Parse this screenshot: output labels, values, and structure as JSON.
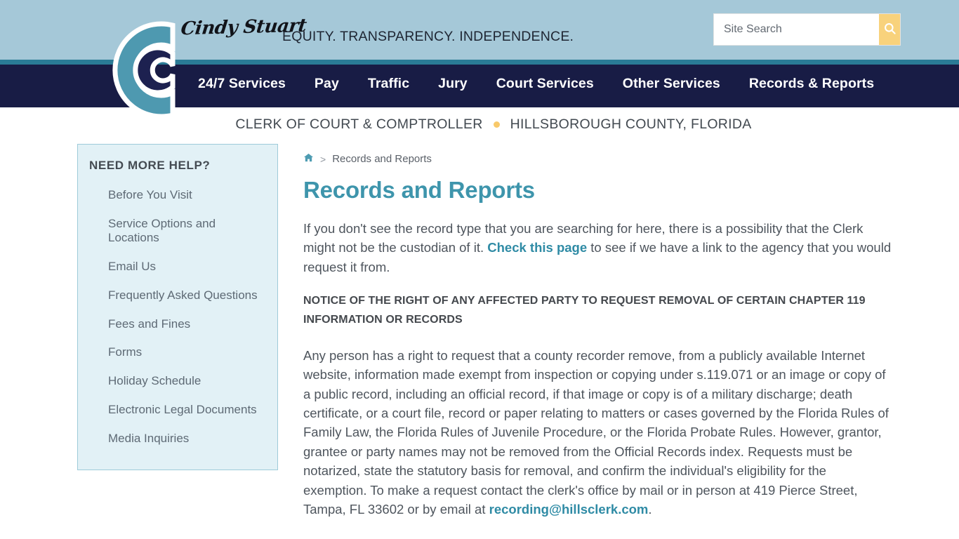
{
  "header": {
    "signature": "Cindy Stuart",
    "tagline": "EQUITY. TRANSPARENCY. INDEPENDENCE.",
    "logo_icon": "nested-c-logo",
    "search": {
      "placeholder": "Site Search",
      "value": "",
      "button_icon": "search-icon"
    }
  },
  "nav": {
    "items": [
      {
        "label": "24/7 Services"
      },
      {
        "label": "Pay"
      },
      {
        "label": "Traffic"
      },
      {
        "label": "Jury"
      },
      {
        "label": "Court Services"
      },
      {
        "label": "Other Services"
      },
      {
        "label": "Records & Reports"
      }
    ]
  },
  "subtitle": {
    "left": "CLERK OF COURT & COMPTROLLER",
    "right": "HILLSBOROUGH COUNTY, FLORIDA",
    "separator_icon": "gold-dot"
  },
  "sidebar": {
    "title": "NEED MORE HELP?",
    "items": [
      {
        "label": "Before You Visit"
      },
      {
        "label": "Service Options and Locations"
      },
      {
        "label": "Email Us"
      },
      {
        "label": "Frequently Asked Questions"
      },
      {
        "label": "Fees and Fines"
      },
      {
        "label": "Forms"
      },
      {
        "label": "Holiday Schedule"
      },
      {
        "label": "Electronic Legal Documents"
      },
      {
        "label": "Media Inquiries"
      }
    ]
  },
  "breadcrumb": {
    "home_icon": "home-icon",
    "separator": ">",
    "current": "Records and Reports"
  },
  "main": {
    "title": "Records and Reports",
    "intro_part1": "If you don't see the record type that you are searching for here, there is a possibility that the Clerk might not be the custodian of it. ",
    "intro_link": "Check this page",
    "intro_part2": " to see if we have a link to the agency that you would request it from.",
    "notice_heading": "NOTICE OF THE RIGHT OF ANY AFFECTED PARTY TO REQUEST REMOVAL OF CERTAIN CHAPTER 119 INFORMATION OR RECORDS",
    "notice_body_part1": "Any person has a right to request that a county recorder remove, from a publicly available Internet website, information made exempt from inspection or copying under s.119.071 or an image or copy of a public record, including an official record, if that image or copy is of a military discharge; death certificate, or a court file, record or paper relating to matters or cases governed by the Florida Rules of Family Law, the Florida Rules of Juvenile Procedure, or the Florida Probate Rules. However, grantor, grantee or party names may not be removed from the Official Records index. Requests must be notarized, state the statutory basis for removal, and confirm the individual's eligibility for the exemption. To make a request contact the clerk's office by mail or in person at 419 Pierce Street, Tampa, FL 33602 or by email at ",
    "notice_email": "recording@hillsclerk.com",
    "notice_body_part2": "."
  },
  "colors": {
    "header_bg": "#a5c8d8",
    "accent_line": "#2a7b96",
    "nav_bg": "#181c45",
    "sidebar_bg": "#e2f1f6",
    "sidebar_border": "#9ecbd9",
    "title_teal": "#3e95ac",
    "link_teal": "#2f8ba5",
    "search_button": "#f8d27c",
    "gold_dot": "#f8c96a"
  }
}
